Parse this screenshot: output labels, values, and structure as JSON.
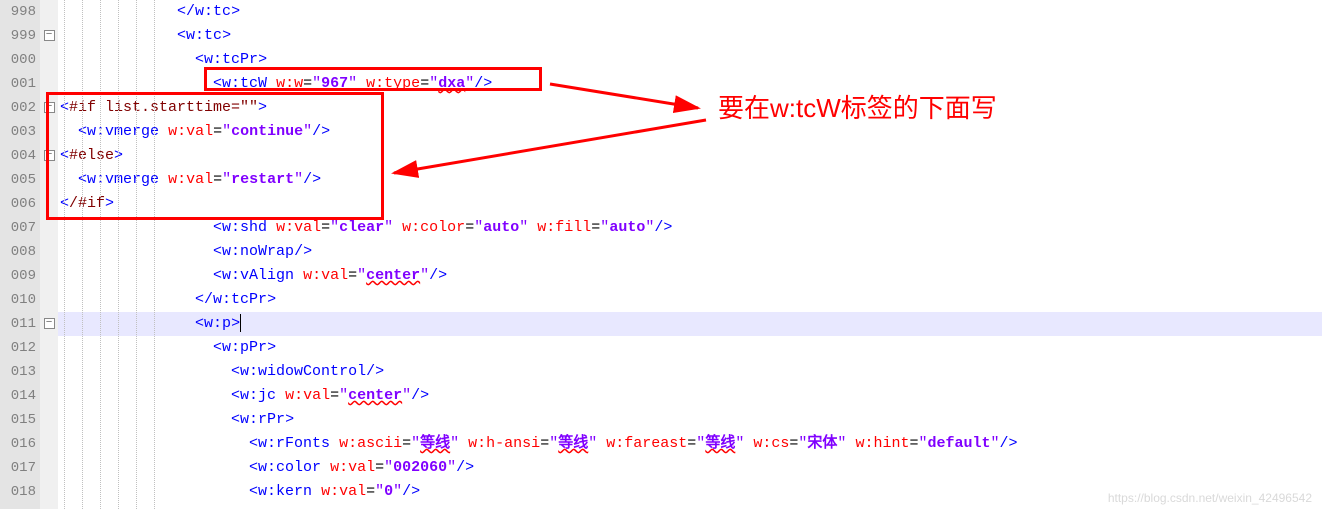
{
  "gutter": [
    "998",
    "999",
    "000",
    "001",
    "002",
    "003",
    "004",
    "005",
    "006",
    "007",
    "008",
    "009",
    "010",
    "011",
    "012",
    "013",
    "014",
    "015",
    "016",
    "017",
    "018"
  ],
  "fold": [
    "",
    "⊟",
    "",
    "",
    "⊟",
    "",
    "⊟",
    "",
    "",
    "",
    "",
    "",
    "",
    "⊟",
    "",
    "",
    "",
    "",
    "",
    "",
    ""
  ],
  "annotation": "要在w:tcW标签的下面写",
  "watermark": "https://blog.csdn.net/weixin_42496542",
  "code": {
    "l0": {
      "indent": "             ",
      "tag": "/w:tc"
    },
    "l1": {
      "indent": "             ",
      "tag": "w:tc"
    },
    "l2": {
      "indent": "               ",
      "tag": "w:tcPr"
    },
    "l3": {
      "indent": "                 ",
      "tag": "w:tcW",
      "a1": "w:w",
      "v1": "967",
      "a2": "w:type",
      "v2": "dxa"
    },
    "l4": {
      "ftl": "#if list.starttime=\"\""
    },
    "l5": {
      "tag": "w:vmerge",
      "a1": "w:val",
      "v1": "continue"
    },
    "l6": {
      "ftl": "#else"
    },
    "l7": {
      "tag": "w:vmerge",
      "a1": "w:val",
      "v1": "restart"
    },
    "l8": {
      "ftl": "/#if"
    },
    "l9": {
      "indent": "                 ",
      "tag": "w:shd",
      "a1": "w:val",
      "v1": "clear",
      "a2": "w:color",
      "v2": "auto",
      "a3": "w:fill",
      "v3": "auto"
    },
    "l10": {
      "indent": "                 ",
      "tag": "w:noWrap"
    },
    "l11": {
      "indent": "                 ",
      "tag": "w:vAlign",
      "a1": "w:val",
      "v1": "center"
    },
    "l12": {
      "indent": "               ",
      "tag": "/w:tcPr"
    },
    "l13": {
      "indent": "               ",
      "tag": "w:p"
    },
    "l14": {
      "indent": "                 ",
      "tag": "w:pPr"
    },
    "l15": {
      "indent": "                   ",
      "tag": "w:widowControl"
    },
    "l16": {
      "indent": "                   ",
      "tag": "w:jc",
      "a1": "w:val",
      "v1": "center"
    },
    "l17": {
      "indent": "                   ",
      "tag": "w:rPr"
    },
    "l18": {
      "indent": "                     ",
      "tag": "w:rFonts",
      "a1": "w:ascii",
      "v1": "等线",
      "a2": "w:h-ansi",
      "v2": "等线",
      "a3": "w:fareast",
      "v3": "等线",
      "a4": "w:cs",
      "v4": "宋体",
      "a5": "w:hint",
      "v5": "default"
    },
    "l19": {
      "indent": "                     ",
      "tag": "w:color",
      "a1": "w:val",
      "v1": "002060"
    },
    "l20": {
      "indent": "                     ",
      "tag": "w:kern",
      "a1": "w:val",
      "v1": "0"
    }
  }
}
